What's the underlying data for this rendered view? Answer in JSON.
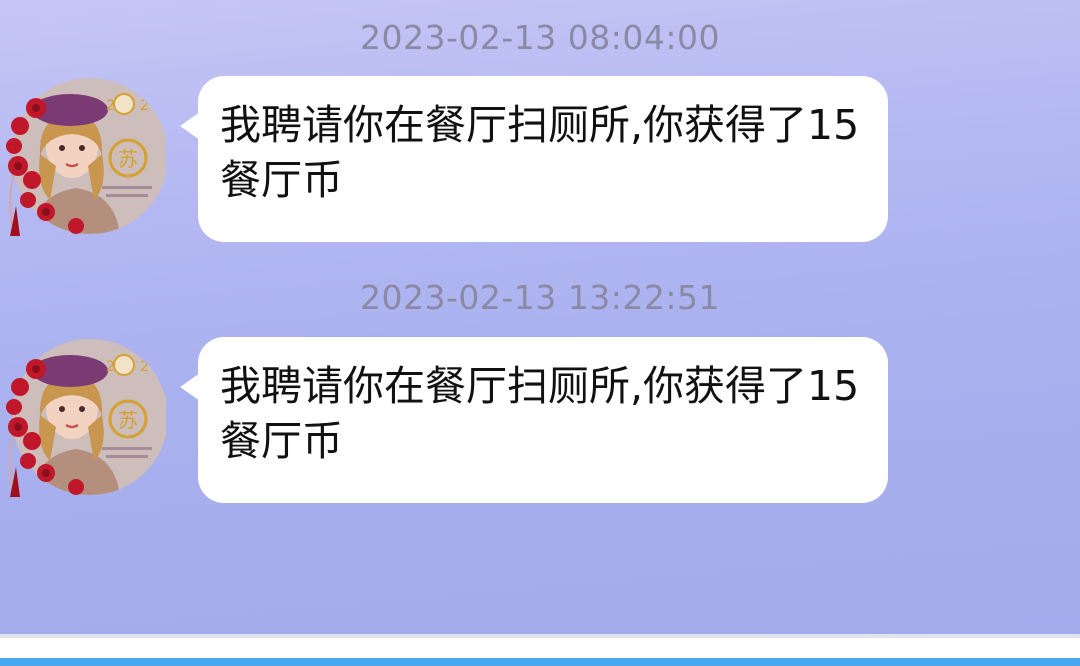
{
  "messages": [
    {
      "timestamp": "2023-02-13 08:04:00",
      "sender_avatar": "avatar-girl-beret-roses",
      "text": "我聘请你在餐厅扫厕所,你获得了15餐厅币"
    },
    {
      "timestamp": "2023-02-13 13:22:51",
      "sender_avatar": "avatar-girl-beret-roses",
      "text": "我聘请你在餐厅扫厕所,你获得了15餐厅币"
    }
  ],
  "colors": {
    "chat_background": "#b4b8f2",
    "bubble": "#ffffff",
    "timestamp_text": "#8a8aa6",
    "accent_bar": "#4aa6ef"
  }
}
